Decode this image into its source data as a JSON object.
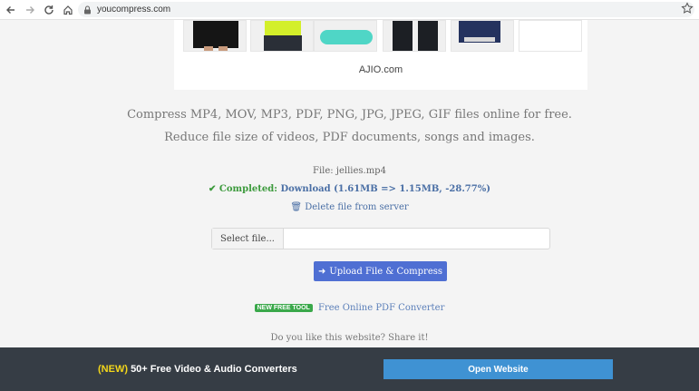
{
  "browser": {
    "url": "youcompress.com"
  },
  "ad": {
    "caption": "AJIO.com"
  },
  "main": {
    "tagline_1": "Compress MP4, MOV, MP3, PDF, PNG, JPG, JPEG, GIF files online for free.",
    "tagline_2": "Reduce file size of videos, PDF documents, songs and images.",
    "file_label": "File: jellies.mp4",
    "status_completed": "Completed:",
    "status_download": "Download (1.61MB => 1.15MB, -28.77%)",
    "delete_label": "Delete file from server",
    "select_file_label": "Select file...",
    "upload_label": "Upload File & Compress",
    "new_badge": "NEW FREE TOOL",
    "pdf_converter_label": "Free Online PDF Converter",
    "share_prompt": "Do you like this website? Share it!"
  },
  "banner": {
    "new_tag": "(NEW)",
    "text": "50+ Free Video & Audio Converters",
    "button_label": "Open Website"
  },
  "colors": {
    "accent": "#4f6fd3",
    "success": "#3c9a3c",
    "link": "#4a6fa5",
    "banner_bg": "#363d45",
    "banner_button": "#3f92d3",
    "new_yellow": "#f3d61a"
  }
}
